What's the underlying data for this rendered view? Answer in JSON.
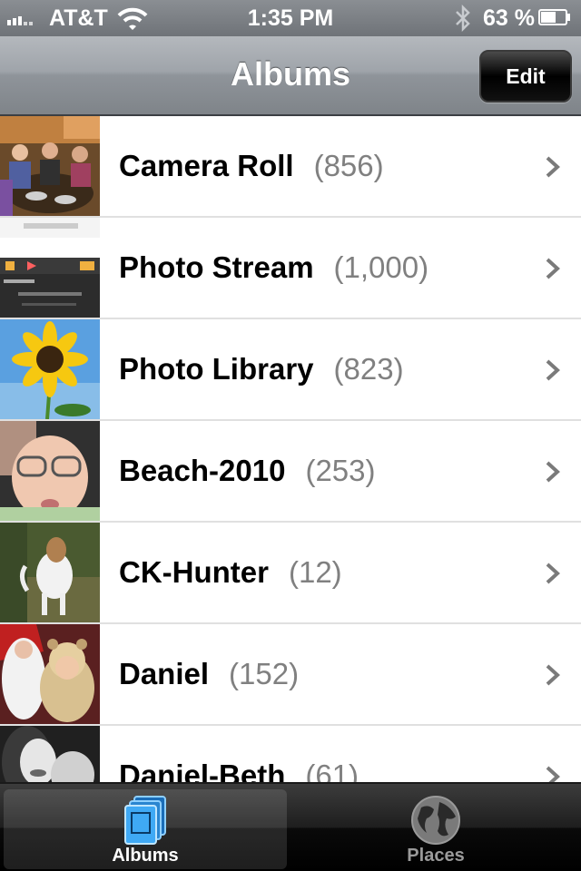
{
  "status_bar": {
    "carrier": "AT&T",
    "time": "1:35 PM",
    "battery_percent": "63 %",
    "battery_level": 0.63
  },
  "nav_bar": {
    "title": "Albums",
    "edit_label": "Edit"
  },
  "albums": [
    {
      "name": "Camera Roll",
      "count": "(856)"
    },
    {
      "name": "Photo Stream",
      "count": "(1,000)"
    },
    {
      "name": "Photo Library",
      "count": "(823)"
    },
    {
      "name": "Beach-2010",
      "count": "(253)"
    },
    {
      "name": "CK-Hunter",
      "count": "(12)"
    },
    {
      "name": "Daniel",
      "count": "(152)"
    },
    {
      "name": "Daniel-Beth",
      "count": "(61)"
    }
  ],
  "tab_bar": {
    "tabs": [
      {
        "label": "Albums",
        "icon": "albums-icon",
        "selected": true
      },
      {
        "label": "Places",
        "icon": "globe-icon",
        "selected": false
      }
    ]
  },
  "colors": {
    "count_text": "#808080",
    "tab_selected": "#3fa9f5",
    "nav_gradient_top": "#b4b8bd",
    "separator": "#e0e0e0"
  }
}
